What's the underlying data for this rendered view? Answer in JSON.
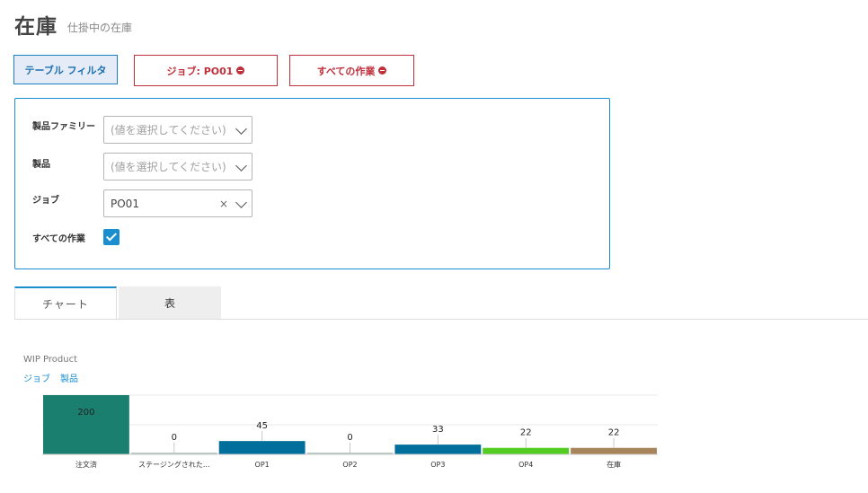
{
  "header": {
    "title": "在庫",
    "subtitle": "仕掛中の在庫"
  },
  "toolbar": {
    "filter_label": "テーブル フィルタ",
    "chips": [
      {
        "label": "ジョブ: PO01"
      },
      {
        "label": "すべての作業"
      }
    ]
  },
  "filters": {
    "product_family": {
      "label": "製品ファミリー",
      "placeholder": "(値を選択してください)"
    },
    "product": {
      "label": "製品",
      "placeholder": "(値を選択してください)"
    },
    "job": {
      "label": "ジョブ",
      "value": "PO01",
      "clear_glyph": "×"
    },
    "all_operations": {
      "label": "すべての作業",
      "checked": true
    }
  },
  "tabs": [
    {
      "label": "チャート",
      "active": true
    },
    {
      "label": "表",
      "active": false
    }
  ],
  "chart": {
    "title": "WIP Product",
    "breadcrumb": [
      "ジョブ",
      "製品"
    ]
  },
  "chart_data": {
    "type": "bar",
    "categories": [
      "注文済",
      "ステージングされた...",
      "OP1",
      "OP2",
      "OP3",
      "OP4",
      "在庫"
    ],
    "values": [
      200,
      0,
      45,
      0,
      33,
      22,
      22
    ],
    "colors": [
      "#1a7f6e",
      "#b5c4c1",
      "#006f9c",
      "#b5c4c1",
      "#006f9c",
      "#52cc20",
      "#a8845a"
    ],
    "ylim": [
      0,
      200
    ],
    "grid": true
  },
  "colors": {
    "accent": "#1a8fcf",
    "danger": "#c0303c"
  }
}
